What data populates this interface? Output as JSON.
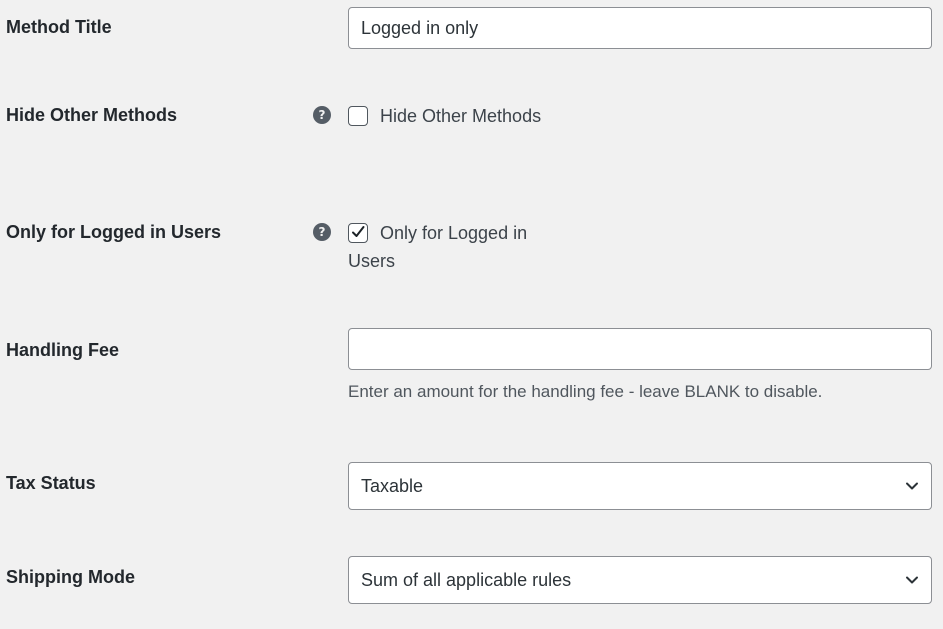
{
  "fields": {
    "method_title": {
      "label": "Method Title",
      "value": "Logged in only"
    },
    "hide_other_methods": {
      "label": "Hide Other Methods",
      "help_icon": "question-circle-icon",
      "checkbox_label": "Hide Other Methods",
      "checked": false
    },
    "only_logged_in": {
      "label": "Only for Logged in Users",
      "help_icon": "question-circle-icon",
      "checkbox_label": "Only for Logged in Users",
      "checked": true
    },
    "handling_fee": {
      "label": "Handling Fee",
      "value": "",
      "description": "Enter an amount for the handling fee - leave BLANK to disable."
    },
    "tax_status": {
      "label": "Tax Status",
      "selected": "Taxable"
    },
    "shipping_mode": {
      "label": "Shipping Mode",
      "selected": "Sum of all applicable rules"
    }
  },
  "icons": {
    "help": "?",
    "dropdown": "chevron-down-icon",
    "check": "checkmark-icon"
  }
}
